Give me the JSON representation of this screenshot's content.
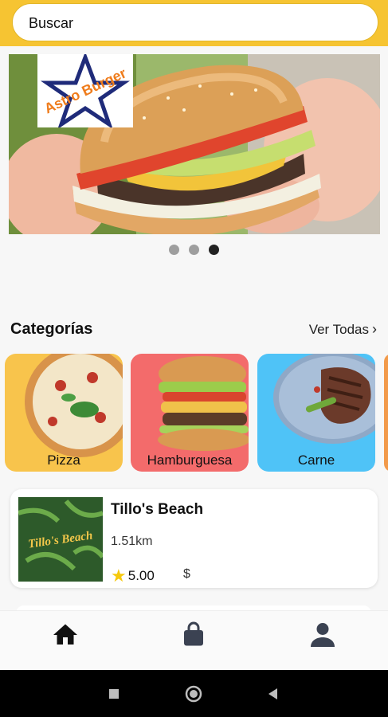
{
  "search": {
    "placeholder": "Buscar"
  },
  "banner": {
    "logo_text": "Astro Burger",
    "dots_count": 3,
    "active_dot": 2
  },
  "categories": {
    "title": "Categorías",
    "see_all": "Ver Todas",
    "items": [
      {
        "label": "Pizza",
        "bg": "#f8c44c"
      },
      {
        "label": "Hamburguesa",
        "bg": "#f36b6b"
      },
      {
        "label": "Carne",
        "bg": "#4fc3f7"
      }
    ]
  },
  "restaurant": {
    "name": "Tillo's Beach",
    "distance": "1.51km",
    "rating": "5.00",
    "price": "$",
    "image_text": "Tillo's Beach"
  },
  "nav": {
    "items": [
      "home-icon",
      "bag-icon",
      "profile-icon"
    ]
  },
  "colors": {
    "accent": "#f6c432",
    "nav_icon": "#3b4252"
  }
}
